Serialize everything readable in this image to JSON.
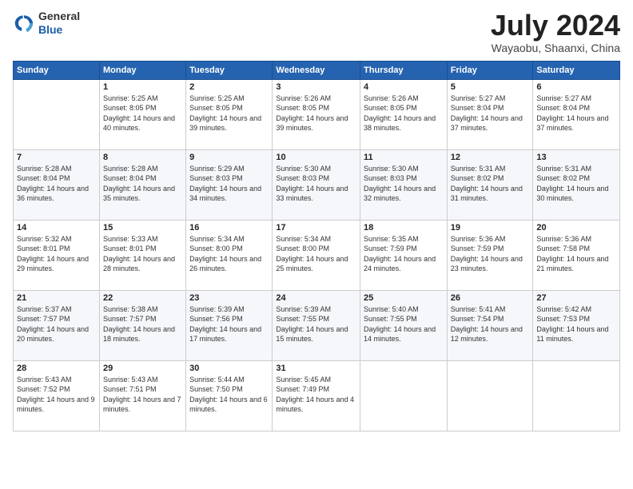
{
  "header": {
    "logo_general": "General",
    "logo_blue": "Blue",
    "month_title": "July 2024",
    "location": "Wayaobu, Shaanxi, China"
  },
  "weekdays": [
    "Sunday",
    "Monday",
    "Tuesday",
    "Wednesday",
    "Thursday",
    "Friday",
    "Saturday"
  ],
  "weeks": [
    [
      {
        "day": "",
        "sunrise": "",
        "sunset": "",
        "daylight": ""
      },
      {
        "day": "1",
        "sunrise": "Sunrise: 5:25 AM",
        "sunset": "Sunset: 8:05 PM",
        "daylight": "Daylight: 14 hours and 40 minutes."
      },
      {
        "day": "2",
        "sunrise": "Sunrise: 5:25 AM",
        "sunset": "Sunset: 8:05 PM",
        "daylight": "Daylight: 14 hours and 39 minutes."
      },
      {
        "day": "3",
        "sunrise": "Sunrise: 5:26 AM",
        "sunset": "Sunset: 8:05 PM",
        "daylight": "Daylight: 14 hours and 39 minutes."
      },
      {
        "day": "4",
        "sunrise": "Sunrise: 5:26 AM",
        "sunset": "Sunset: 8:05 PM",
        "daylight": "Daylight: 14 hours and 38 minutes."
      },
      {
        "day": "5",
        "sunrise": "Sunrise: 5:27 AM",
        "sunset": "Sunset: 8:04 PM",
        "daylight": "Daylight: 14 hours and 37 minutes."
      },
      {
        "day": "6",
        "sunrise": "Sunrise: 5:27 AM",
        "sunset": "Sunset: 8:04 PM",
        "daylight": "Daylight: 14 hours and 37 minutes."
      }
    ],
    [
      {
        "day": "7",
        "sunrise": "Sunrise: 5:28 AM",
        "sunset": "Sunset: 8:04 PM",
        "daylight": "Daylight: 14 hours and 36 minutes."
      },
      {
        "day": "8",
        "sunrise": "Sunrise: 5:28 AM",
        "sunset": "Sunset: 8:04 PM",
        "daylight": "Daylight: 14 hours and 35 minutes."
      },
      {
        "day": "9",
        "sunrise": "Sunrise: 5:29 AM",
        "sunset": "Sunset: 8:03 PM",
        "daylight": "Daylight: 14 hours and 34 minutes."
      },
      {
        "day": "10",
        "sunrise": "Sunrise: 5:30 AM",
        "sunset": "Sunset: 8:03 PM",
        "daylight": "Daylight: 14 hours and 33 minutes."
      },
      {
        "day": "11",
        "sunrise": "Sunrise: 5:30 AM",
        "sunset": "Sunset: 8:03 PM",
        "daylight": "Daylight: 14 hours and 32 minutes."
      },
      {
        "day": "12",
        "sunrise": "Sunrise: 5:31 AM",
        "sunset": "Sunset: 8:02 PM",
        "daylight": "Daylight: 14 hours and 31 minutes."
      },
      {
        "day": "13",
        "sunrise": "Sunrise: 5:31 AM",
        "sunset": "Sunset: 8:02 PM",
        "daylight": "Daylight: 14 hours and 30 minutes."
      }
    ],
    [
      {
        "day": "14",
        "sunrise": "Sunrise: 5:32 AM",
        "sunset": "Sunset: 8:01 PM",
        "daylight": "Daylight: 14 hours and 29 minutes."
      },
      {
        "day": "15",
        "sunrise": "Sunrise: 5:33 AM",
        "sunset": "Sunset: 8:01 PM",
        "daylight": "Daylight: 14 hours and 28 minutes."
      },
      {
        "day": "16",
        "sunrise": "Sunrise: 5:34 AM",
        "sunset": "Sunset: 8:00 PM",
        "daylight": "Daylight: 14 hours and 26 minutes."
      },
      {
        "day": "17",
        "sunrise": "Sunrise: 5:34 AM",
        "sunset": "Sunset: 8:00 PM",
        "daylight": "Daylight: 14 hours and 25 minutes."
      },
      {
        "day": "18",
        "sunrise": "Sunrise: 5:35 AM",
        "sunset": "Sunset: 7:59 PM",
        "daylight": "Daylight: 14 hours and 24 minutes."
      },
      {
        "day": "19",
        "sunrise": "Sunrise: 5:36 AM",
        "sunset": "Sunset: 7:59 PM",
        "daylight": "Daylight: 14 hours and 23 minutes."
      },
      {
        "day": "20",
        "sunrise": "Sunrise: 5:36 AM",
        "sunset": "Sunset: 7:58 PM",
        "daylight": "Daylight: 14 hours and 21 minutes."
      }
    ],
    [
      {
        "day": "21",
        "sunrise": "Sunrise: 5:37 AM",
        "sunset": "Sunset: 7:57 PM",
        "daylight": "Daylight: 14 hours and 20 minutes."
      },
      {
        "day": "22",
        "sunrise": "Sunrise: 5:38 AM",
        "sunset": "Sunset: 7:57 PM",
        "daylight": "Daylight: 14 hours and 18 minutes."
      },
      {
        "day": "23",
        "sunrise": "Sunrise: 5:39 AM",
        "sunset": "Sunset: 7:56 PM",
        "daylight": "Daylight: 14 hours and 17 minutes."
      },
      {
        "day": "24",
        "sunrise": "Sunrise: 5:39 AM",
        "sunset": "Sunset: 7:55 PM",
        "daylight": "Daylight: 14 hours and 15 minutes."
      },
      {
        "day": "25",
        "sunrise": "Sunrise: 5:40 AM",
        "sunset": "Sunset: 7:55 PM",
        "daylight": "Daylight: 14 hours and 14 minutes."
      },
      {
        "day": "26",
        "sunrise": "Sunrise: 5:41 AM",
        "sunset": "Sunset: 7:54 PM",
        "daylight": "Daylight: 14 hours and 12 minutes."
      },
      {
        "day": "27",
        "sunrise": "Sunrise: 5:42 AM",
        "sunset": "Sunset: 7:53 PM",
        "daylight": "Daylight: 14 hours and 11 minutes."
      }
    ],
    [
      {
        "day": "28",
        "sunrise": "Sunrise: 5:43 AM",
        "sunset": "Sunset: 7:52 PM",
        "daylight": "Daylight: 14 hours and 9 minutes."
      },
      {
        "day": "29",
        "sunrise": "Sunrise: 5:43 AM",
        "sunset": "Sunset: 7:51 PM",
        "daylight": "Daylight: 14 hours and 7 minutes."
      },
      {
        "day": "30",
        "sunrise": "Sunrise: 5:44 AM",
        "sunset": "Sunset: 7:50 PM",
        "daylight": "Daylight: 14 hours and 6 minutes."
      },
      {
        "day": "31",
        "sunrise": "Sunrise: 5:45 AM",
        "sunset": "Sunset: 7:49 PM",
        "daylight": "Daylight: 14 hours and 4 minutes."
      },
      {
        "day": "",
        "sunrise": "",
        "sunset": "",
        "daylight": ""
      },
      {
        "day": "",
        "sunrise": "",
        "sunset": "",
        "daylight": ""
      },
      {
        "day": "",
        "sunrise": "",
        "sunset": "",
        "daylight": ""
      }
    ]
  ]
}
